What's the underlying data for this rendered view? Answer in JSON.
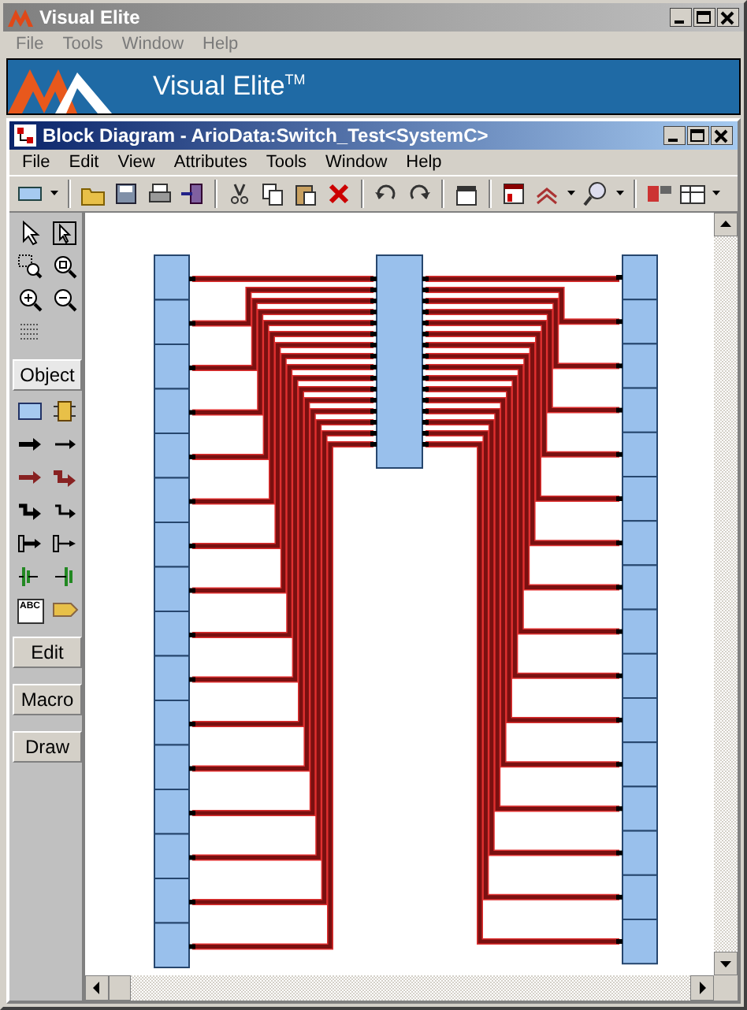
{
  "app_window": {
    "title": "Visual Elite",
    "menu": [
      "File",
      "Tools",
      "Window",
      "Help"
    ],
    "banner": "Visual Elite$^{TM}$"
  },
  "document_window": {
    "title": "Block Diagram - ArioData:Switch_Test<SystemC>",
    "menu": [
      "File",
      "Edit",
      "View",
      "Attributes",
      "Tools",
      "Window",
      "Help"
    ]
  },
  "palette": {
    "sections": [
      {
        "label": "Object",
        "selected": true,
        "text_tool_label": "ABC"
      },
      {
        "label": "Edit",
        "selected": false
      },
      {
        "label": "Macro",
        "selected": false
      },
      {
        "label": "Draw",
        "selected": false
      }
    ]
  }
}
